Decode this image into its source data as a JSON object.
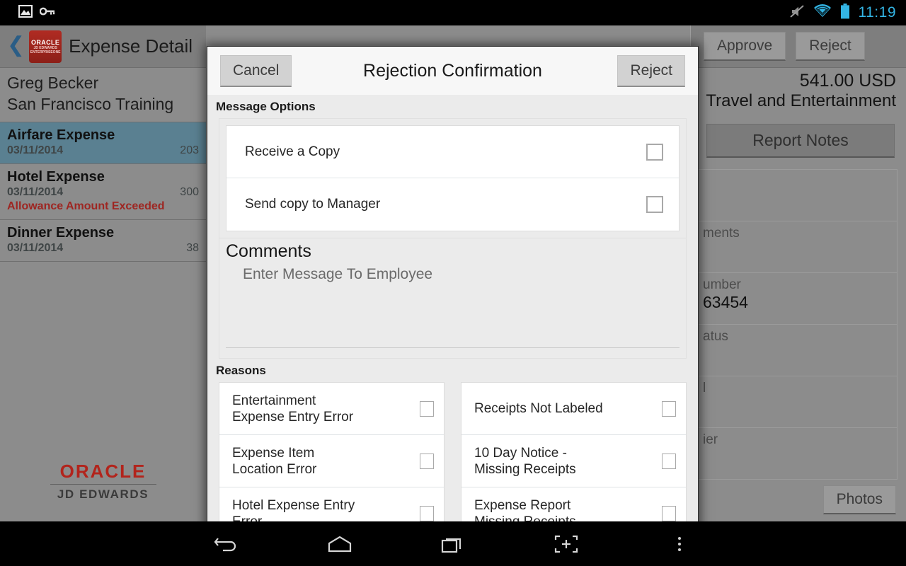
{
  "status_bar": {
    "icons": [
      "image-icon",
      "key-icon",
      "mute-icon",
      "wifi-icon",
      "battery-icon"
    ],
    "time": "11:19",
    "accent_color": "#33b5e5"
  },
  "app": {
    "title": "Expense Detail",
    "back_icon": "back-chevron-icon",
    "logo": {
      "line1": "ORACLE",
      "line2": "JD EDWARDS ENTERPRISEONE"
    },
    "employee": "Greg Becker",
    "purpose": "San Francisco Training",
    "expenses": [
      {
        "name": "Airfare Expense",
        "date": "03/11/2014",
        "amount": "203",
        "warning": "",
        "selected": true
      },
      {
        "name": "Hotel Expense",
        "date": "03/11/2014",
        "amount": "300",
        "warning": "Allowance Amount Exceeded",
        "selected": false
      },
      {
        "name": "Dinner Expense",
        "date": "03/11/2014",
        "amount": "38",
        "warning": "",
        "selected": false
      }
    ],
    "footer_logo": {
      "top": "ORACLE",
      "bottom": "JD EDWARDS"
    },
    "warning_color": "#9e2622",
    "selected_row_color": "#5a8091"
  },
  "detail_pane": {
    "approve_label": "Approve",
    "reject_label": "Reject",
    "amount": "541.00 USD",
    "category": "Travel and Entertainment",
    "report_notes_label": "Report Notes",
    "fields": [
      {
        "label": "",
        "value": ""
      },
      {
        "label": "ments",
        "value": ""
      },
      {
        "label": "umber",
        "value": "63454"
      },
      {
        "label": "atus",
        "value": ""
      },
      {
        "label": "l",
        "value": ""
      },
      {
        "label": "ier",
        "value": ""
      }
    ],
    "photos_label": "Photos"
  },
  "dialog": {
    "title": "Rejection Confirmation",
    "cancel_label": "Cancel",
    "reject_label": "Reject",
    "message_options_label": "Message Options",
    "message_options": [
      {
        "label": "Receive a Copy",
        "checked": false
      },
      {
        "label": "Send copy to Manager",
        "checked": false
      }
    ],
    "comments_label": "Comments",
    "comments_value": "",
    "comments_placeholder": "Enter Message To Employee",
    "reasons_label": "Reasons",
    "reasons_left": [
      {
        "label": "Entertainment\nExpense Entry Error",
        "checked": false
      },
      {
        "label": "Expense Item\nLocation Error",
        "checked": false
      },
      {
        "label": "Hotel Expense Entry\nError",
        "checked": false
      }
    ],
    "reasons_right": [
      {
        "label": "Receipts Not Labeled",
        "checked": false
      },
      {
        "label": "10 Day Notice -\nMissing Receipts",
        "checked": false
      },
      {
        "label": "Expense Report\nMissing Receipts",
        "checked": false
      }
    ]
  },
  "navbar": {
    "items": [
      "back-icon",
      "home-icon",
      "recents-icon",
      "screenshot-add-icon",
      "overflow-menu-icon"
    ]
  }
}
